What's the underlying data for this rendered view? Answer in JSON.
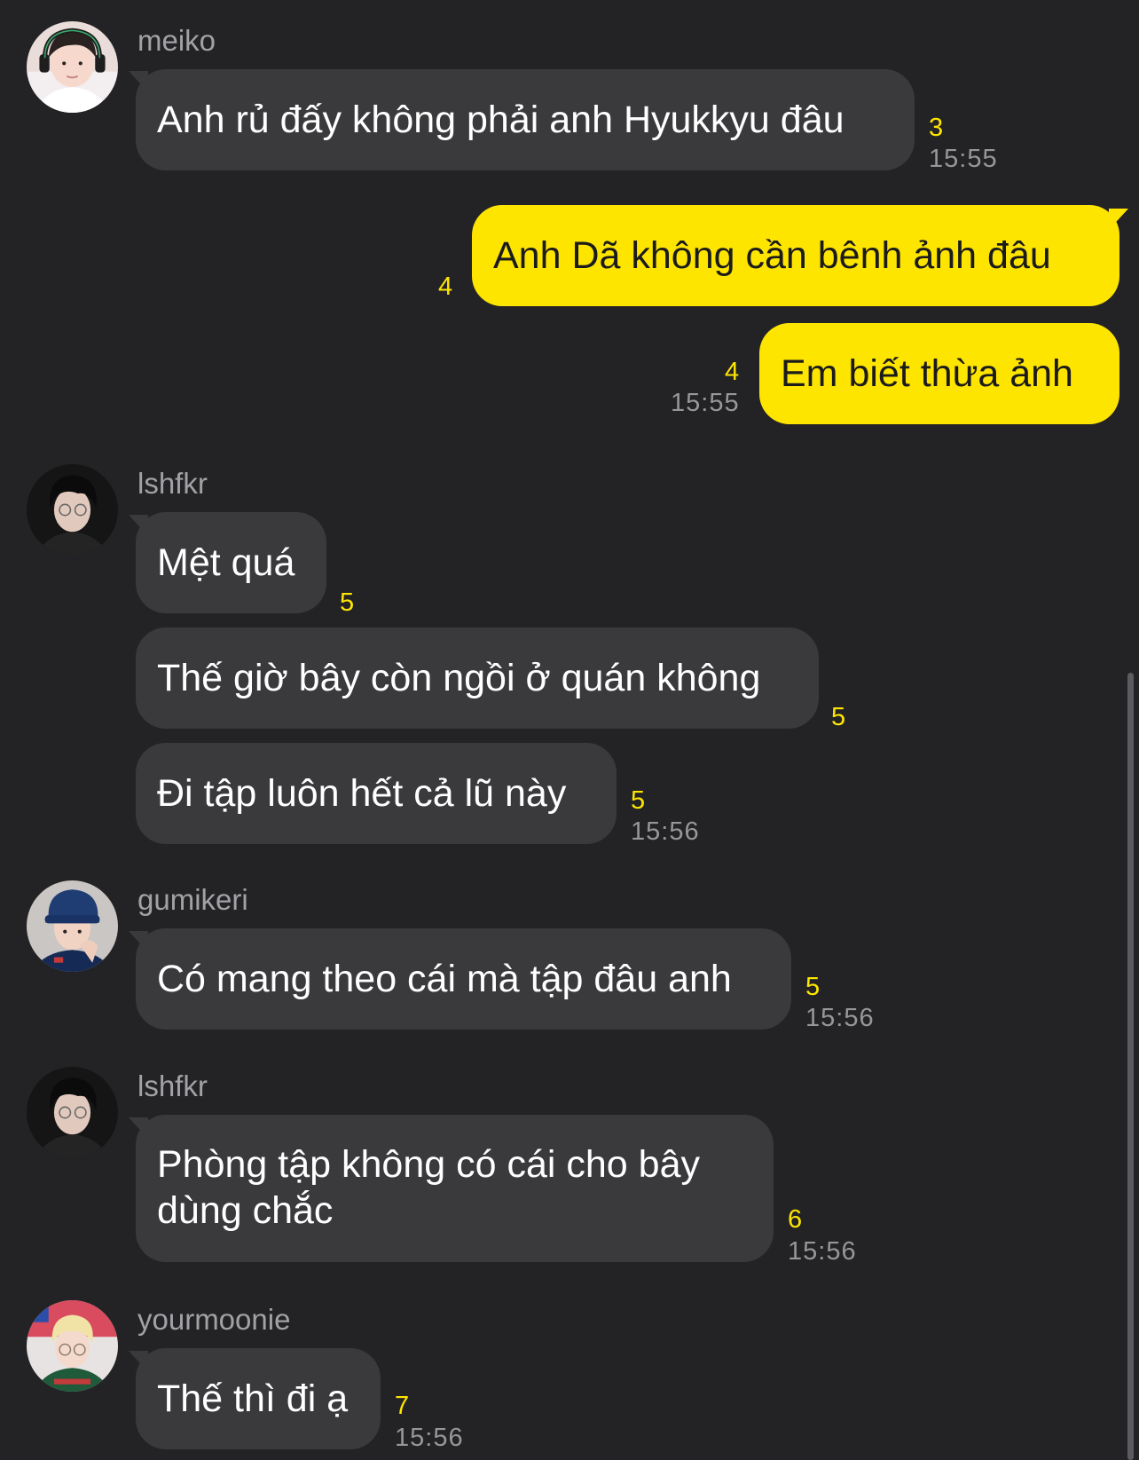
{
  "messages": [
    {
      "sender": "meiko",
      "text": "Anh rủ đấy không phải anh Hyukkyu đâu",
      "unread": "3",
      "time": "15:55"
    },
    {
      "text": "Anh Dã không cần bênh ảnh đâu",
      "unread": "4"
    },
    {
      "text": "Em biết thừa ảnh",
      "unread": "4",
      "time": "15:55"
    },
    {
      "sender": "lshfkr",
      "text": "Mệt quá",
      "unread": "5"
    },
    {
      "text": "Thế giờ bây còn ngồi ở quán không",
      "unread": "5"
    },
    {
      "text": "Đi tập luôn hết cả lũ này",
      "unread": "5",
      "time": "15:56"
    },
    {
      "sender": "gumikeri",
      "text": "Có mang theo cái mà tập đâu anh",
      "unread": "5",
      "time": "15:56"
    },
    {
      "sender": "lshfkr",
      "text": "Phòng tập không có cái cho bây dùng chắc",
      "unread": "6",
      "time": "15:56"
    },
    {
      "sender": "yourmoonie",
      "text": "Thế thì đi ạ",
      "unread": "7",
      "time": "15:56"
    }
  ],
  "colors": {
    "background": "#232325",
    "incoming_bubble": "#3a3a3d",
    "outgoing_bubble": "#fee500",
    "unread_count": "#fee500",
    "timestamp": "#97979b"
  }
}
